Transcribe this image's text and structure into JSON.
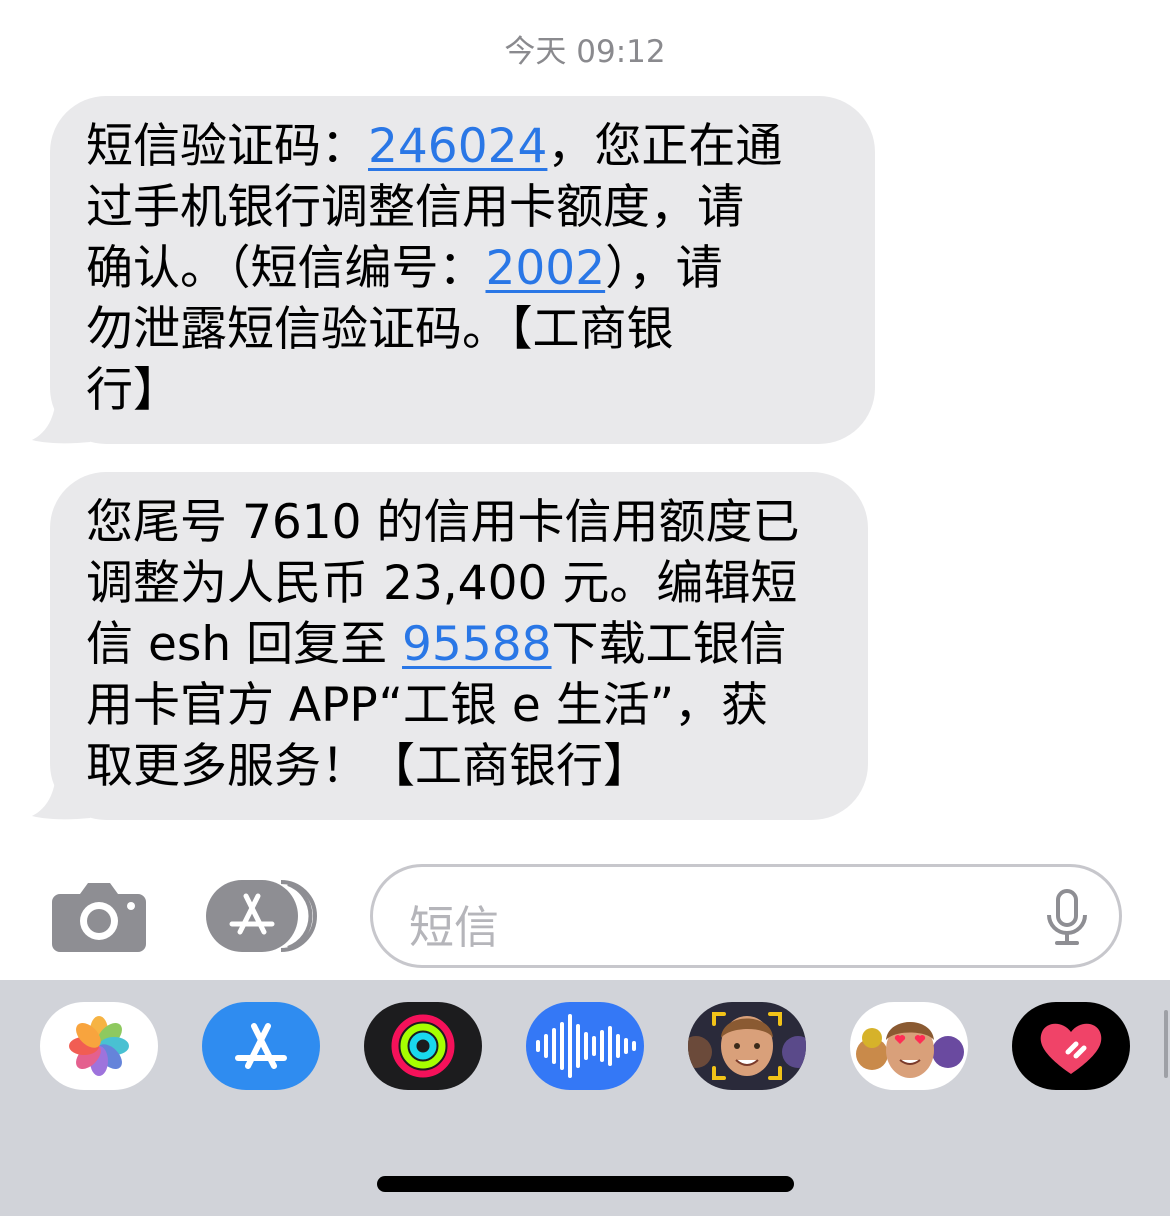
{
  "header": {
    "timestamp": "今天 09:12"
  },
  "messages": [
    {
      "lines": [
        {
          "parts": [
            {
              "text": "短信验证码："
            },
            {
              "text": "246024",
              "link": true
            },
            {
              "text": "，您正在通"
            }
          ]
        },
        {
          "parts": [
            {
              "text": "过手机银行调整信用卡额度，请"
            }
          ]
        },
        {
          "parts": [
            {
              "text": "确认。（短信编号："
            },
            {
              "text": "2002",
              "link": true
            },
            {
              "text": "），请"
            }
          ]
        },
        {
          "parts": [
            {
              "text": "勿泄露短信验证码。【工商银"
            }
          ]
        },
        {
          "parts": [
            {
              "text": "行】"
            }
          ]
        }
      ]
    },
    {
      "lines": [
        {
          "parts": [
            {
              "text": "您尾号 7610 的信用卡信用额度已"
            }
          ]
        },
        {
          "parts": [
            {
              "text": "调整为人民币 23,400 元。编辑短"
            }
          ]
        },
        {
          "parts": [
            {
              "text": "信 esh 回复至 "
            },
            {
              "text": "95588",
              "link": true
            },
            {
              "text": "下载工银信"
            }
          ]
        },
        {
          "parts": [
            {
              "text": "用卡官方 APP“工银 e 生活”，获"
            }
          ]
        },
        {
          "parts": [
            {
              "text": "取更多服务！【工商银行】"
            }
          ]
        }
      ]
    }
  ],
  "compose": {
    "placeholder": "短信",
    "camera_icon": "camera-icon",
    "apps_icon": "app-store-icon",
    "mic_icon": "microphone-icon"
  },
  "app_drawer": {
    "apps": [
      {
        "name": "photos-app",
        "icon": "photos-icon"
      },
      {
        "name": "app-store-app",
        "icon": "app-store-icon"
      },
      {
        "name": "activity-app",
        "icon": "activity-rings-icon"
      },
      {
        "name": "audio-message-app",
        "icon": "waveform-icon"
      },
      {
        "name": "memoji-app",
        "icon": "memoji-icon"
      },
      {
        "name": "memoji-stickers-app",
        "icon": "memoji-stickers-icon"
      },
      {
        "name": "digital-touch-app",
        "icon": "heart-icon"
      }
    ]
  },
  "colors": {
    "bubble": "#e9e9eb",
    "link": "#2a77e6",
    "drawer": "#d1d3d9",
    "timestamp": "#8a8a8e"
  }
}
